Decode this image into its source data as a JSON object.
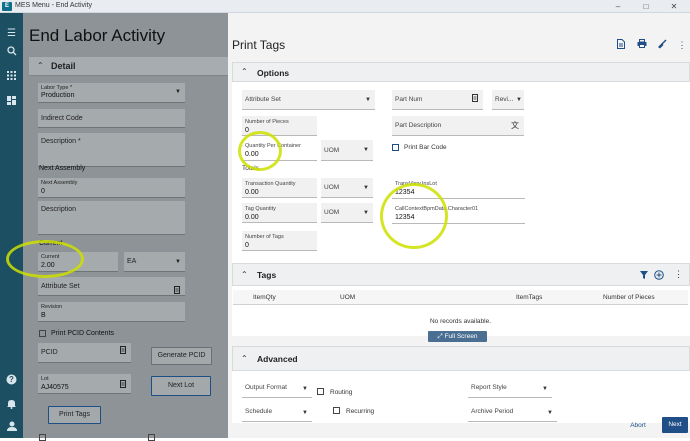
{
  "window": {
    "title": "MES Menu - End Activity",
    "app_icon": "E"
  },
  "left": {
    "heading": "End Labor Activity",
    "detail_label": "Detail",
    "labor_type": {
      "label": "Labor Type *",
      "value": "Production"
    },
    "indirect_code": "Indirect Code",
    "description": "Description *",
    "next_assembly_label": "Next Assembly",
    "next_assembly_field": {
      "label": "Next Assembly",
      "value": "0"
    },
    "next_desc": "Description",
    "current_label": "Current",
    "current_field": {
      "label": "Current",
      "value": "2.00"
    },
    "uom": "EA",
    "attribute_set": "Attribute Set",
    "revision": {
      "label": "Revision",
      "value": "B"
    },
    "print_pcid": "Print PCID Contents",
    "pcid": "PCID",
    "generate_pcid": "Generate PCID",
    "lot": {
      "label": "Lot",
      "value": "AJ40575"
    },
    "next_lot": "Next Lot",
    "print_tags": "Print Tags"
  },
  "right": {
    "title": "Print Tags",
    "options_label": "Options",
    "attribute_set": "Attribute Set",
    "part_num": "Part Num",
    "revi": "Revi...",
    "number_of_pieces": {
      "label": "Number of Pieces",
      "value": "0"
    },
    "part_description": "Part Description",
    "qty_per_container": {
      "label": "Quantity Per Container",
      "value": "0.00"
    },
    "uom": "UOM",
    "print_bar_code": "Print Bar Code",
    "totals": "Totals",
    "transaction_quantity": {
      "label": "Transaction Quantity",
      "value": "0.00"
    },
    "tag_quantity": {
      "label": "Tag Quantity",
      "value": "0.00"
    },
    "number_of_tags": {
      "label": "Number of Tags",
      "value": "0"
    },
    "transview": {
      "label": "TransView.InsLot",
      "value": "12354"
    },
    "callcontext": {
      "label": "CallContextBpmData.Character01",
      "value": "12354"
    },
    "tags_label": "Tags",
    "columns": [
      "ItemQty",
      "UOM",
      "ItemTags",
      "Number of Pieces"
    ],
    "no_records": "No records available.",
    "full_screen": "Full Screen",
    "advanced_label": "Advanced",
    "output_format": "Output Format",
    "routing": "Routing",
    "report_style": "Report Style",
    "schedule": "Schedule",
    "recurring": "Recurring",
    "archive_period": "Archive Period",
    "abort": "Abort",
    "next": "Next"
  },
  "colors": {
    "rail": "#1d4f63",
    "accent": "#1f4f86",
    "highlight": "#d4e600"
  }
}
